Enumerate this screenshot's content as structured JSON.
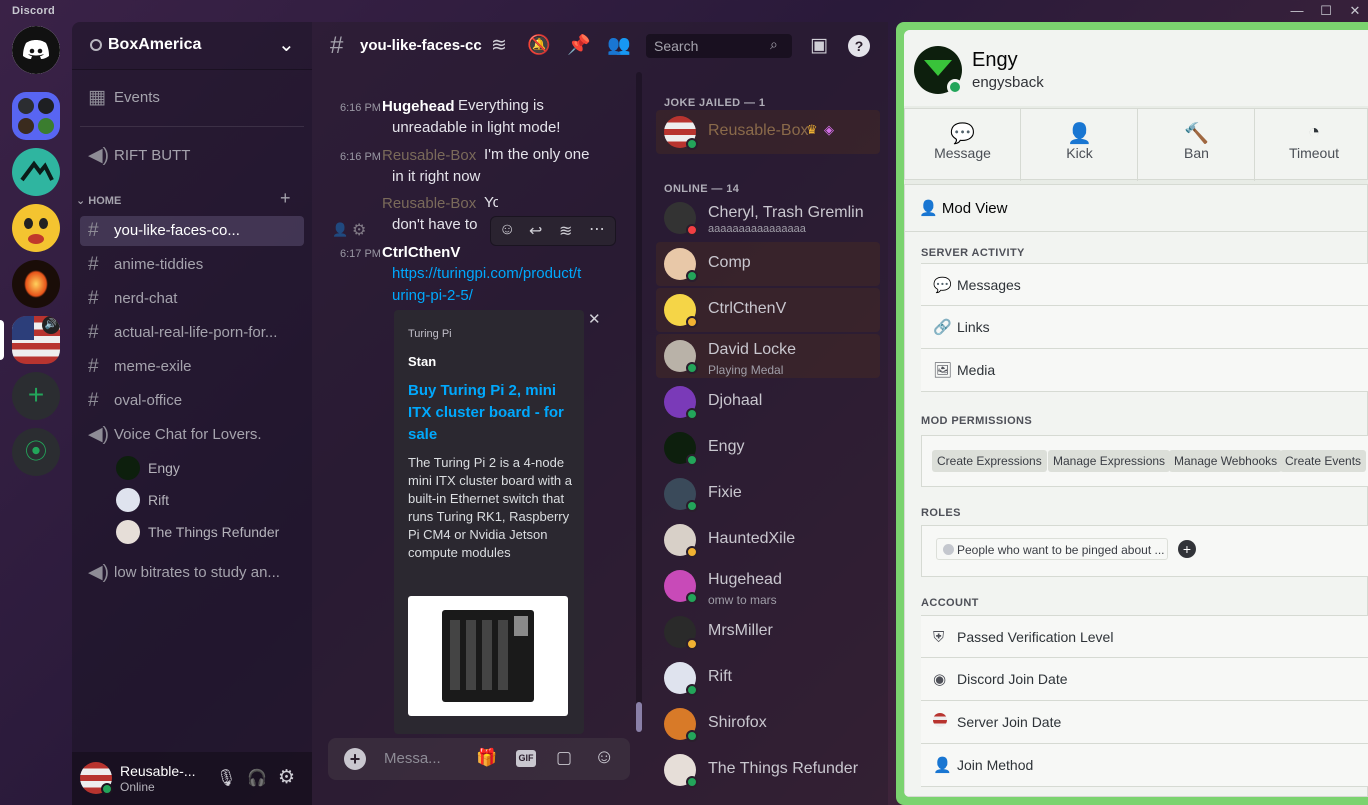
{
  "titlebar": {
    "app_name": "Discord",
    "minimize": "—",
    "maximize": "☐",
    "close": "✕"
  },
  "server_rail": {
    "add_server": "+",
    "explore": "⦿"
  },
  "guild": {
    "name": "BoxAmerica",
    "dropdown": "⌄"
  },
  "channels": {
    "events": "Events",
    "rift_butt": "RIFT BUTT",
    "category_home": "HOME",
    "items": [
      {
        "name": "you-like-faces-co...",
        "icon": "#"
      },
      {
        "name": "anime-tiddies",
        "icon": "#"
      },
      {
        "name": "nerd-chat",
        "icon": "#"
      },
      {
        "name": "actual-real-life-porn-for...",
        "icon": "#"
      },
      {
        "name": "meme-exile",
        "icon": "#"
      },
      {
        "name": "oval-office",
        "icon": "#"
      }
    ],
    "voice_channel": "Voice Chat for Lovers.",
    "voice_users": [
      "Engy",
      "Rift",
      "The Things Refunder"
    ],
    "voice_channel_2": "low bitrates to study an..."
  },
  "user_panel": {
    "name": "Reusable-...",
    "status": "Online"
  },
  "chat_header": {
    "channel": "you-like-faces-cc",
    "search_placeholder": "Search"
  },
  "messages": [
    {
      "time": "6:16 PM",
      "author": "Hugehead",
      "text": "Everything is unreadable in light mode!"
    },
    {
      "time": "6:16 PM",
      "author": "Reusable-Box",
      "text": "I'm the only one in it right now"
    },
    {
      "author": "Reusable-Box",
      "text": "You don't have to live thi"
    },
    {
      "time": "6:17 PM",
      "author": "CtrlCthenV",
      "link": "https://turingpi.com/product/turing-pi-2-5/"
    }
  ],
  "embed": {
    "provider": "Turing Pi",
    "author": "Stan",
    "title": "Buy Turing Pi 2, mini ITX cluster board - for sale",
    "description": "The Turing Pi 2 is a 4-node mini ITX cluster board with a built-in Ethernet switch that runs Turing RK1, Raspberry Pi CM4 or Nvidia Jetson compute modules",
    "close": "✕"
  },
  "composer": {
    "placeholder": "Messa...",
    "gif": "GIF"
  },
  "members": {
    "group_jailed": "JOKE JAILED — 1",
    "group_online": "ONLINE — 14",
    "jailed": [
      {
        "name": "Reusable-Box"
      }
    ],
    "online": [
      {
        "name": "Cheryl, Trash Gremlin",
        "sub": "aaaaaaaaaaaaaaaa"
      },
      {
        "name": "Comp",
        "sub": ""
      },
      {
        "name": "CtrlCthenV",
        "sub": ""
      },
      {
        "name": "David Locke",
        "sub": "Playing Medal"
      },
      {
        "name": "Djohaal",
        "sub": ""
      },
      {
        "name": "Engy",
        "sub": ""
      },
      {
        "name": "Fixie",
        "sub": ""
      },
      {
        "name": "HauntedXile",
        "sub": ""
      },
      {
        "name": "Hugehead",
        "sub": "omw to mars"
      },
      {
        "name": "MrsMiller",
        "sub": ""
      },
      {
        "name": "Rift",
        "sub": ""
      },
      {
        "name": "Shirofox",
        "sub": ""
      },
      {
        "name": "The Things Refunder",
        "sub": ""
      }
    ]
  },
  "profile": {
    "display_name": "Engy",
    "username": "engysback",
    "actions": [
      "Message",
      "Kick",
      "Ban",
      "Timeout"
    ],
    "mod_view": "Mod View",
    "server_activity": "SERVER ACTIVITY",
    "activity_rows": [
      "Messages",
      "Links",
      "Media"
    ],
    "mod_permissions": "MOD PERMISSIONS",
    "permissions": [
      "Create Expressions",
      "Manage Expressions",
      "Manage Webhooks",
      "Create Events"
    ],
    "roles_title": "ROLES",
    "role": "People who want to be pinged about ...",
    "account_title": "ACCOUNT",
    "account_rows": [
      "Passed Verification Level",
      "Discord Join Date",
      "Server Join Date",
      "Join Method"
    ]
  },
  "colors": {
    "online": "#23a55a",
    "link": "#00a8fc",
    "profile_accent": "#7bd36f"
  }
}
